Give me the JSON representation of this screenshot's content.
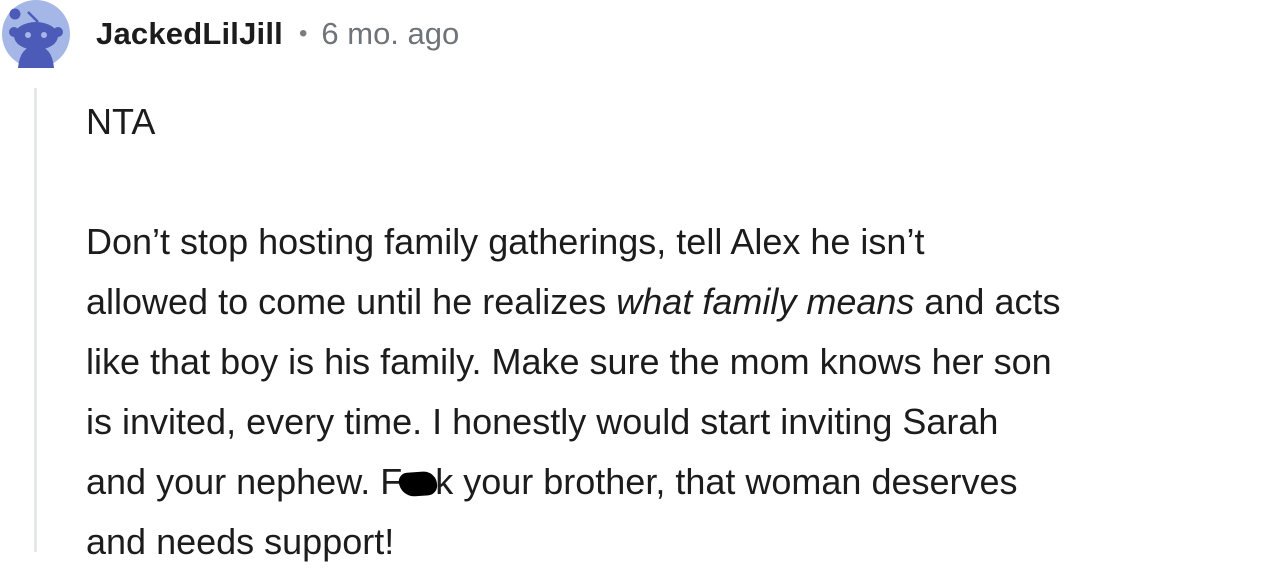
{
  "comment": {
    "username": "JackedLilJill",
    "separator": "•",
    "time": "6 mo. ago",
    "verdict": "NTA",
    "lines": [
      {
        "a": "Don’t stop hosting family gatherings, tell Alex he isn’t"
      },
      {
        "a": "allowed to come until he realizes ",
        "em": "what family means",
        "b": " and acts"
      },
      {
        "a": "like that boy is his family. Make sure the mom knows her son"
      },
      {
        "a": "is invited, every time. I honestly would start inviting Sarah"
      },
      {
        "a": "and your nephew. F",
        "b": "k your brother, that woman deserves"
      },
      {
        "a": "and needs support!"
      }
    ]
  },
  "colors": {
    "avatar_bg": "#a5b7e6",
    "avatar_figure": "#4d5bb8",
    "thread_line": "#e5e7ea",
    "text": "#1c1c1c",
    "meta": "#6f7478",
    "censor": "#000000"
  },
  "icons": {
    "avatar": "snoo-avatar-icon"
  }
}
